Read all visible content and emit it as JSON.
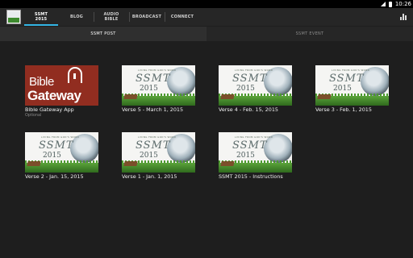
{
  "status_bar": {
    "time": "10:26"
  },
  "tabs": [
    {
      "label_line1": "SSMT",
      "label_line2": "2015"
    },
    {
      "label_line1": "BLOG",
      "label_line2": ""
    },
    {
      "label_line1": "AUDIO",
      "label_line2": "BIBLE"
    },
    {
      "label_line1": "BROADCAST",
      "label_line2": ""
    },
    {
      "label_line1": "CONNECT",
      "label_line2": ""
    }
  ],
  "subtabs": [
    "SSMT POST",
    "SSMT EVENT"
  ],
  "thumb_text": {
    "tagline": "LIVING FROM GOD'S WORD",
    "ssmt": "SSMT",
    "year": "2015",
    "bible": "Bible",
    "gateway": "Gateway"
  },
  "cards": [
    {
      "title": "Bible Gateway App",
      "subtitle": "Optional"
    },
    {
      "title": "Verse 5 - March 1, 2015",
      "subtitle": ""
    },
    {
      "title": "Verse 4 - Feb. 15, 2015",
      "subtitle": ""
    },
    {
      "title": "Verse 3 - Feb. 1, 2015",
      "subtitle": ""
    },
    {
      "title": "Verse 2 - Jan. 15, 2015",
      "subtitle": ""
    },
    {
      "title": "Verse 1 - Jan. 1, 2015",
      "subtitle": ""
    },
    {
      "title": "SSMT 2015 - Instructions",
      "subtitle": ""
    }
  ],
  "colors": {
    "accent": "#33b5e5",
    "bible_gateway_red": "#912d20"
  },
  "icons": {
    "action": "chart-icon"
  }
}
